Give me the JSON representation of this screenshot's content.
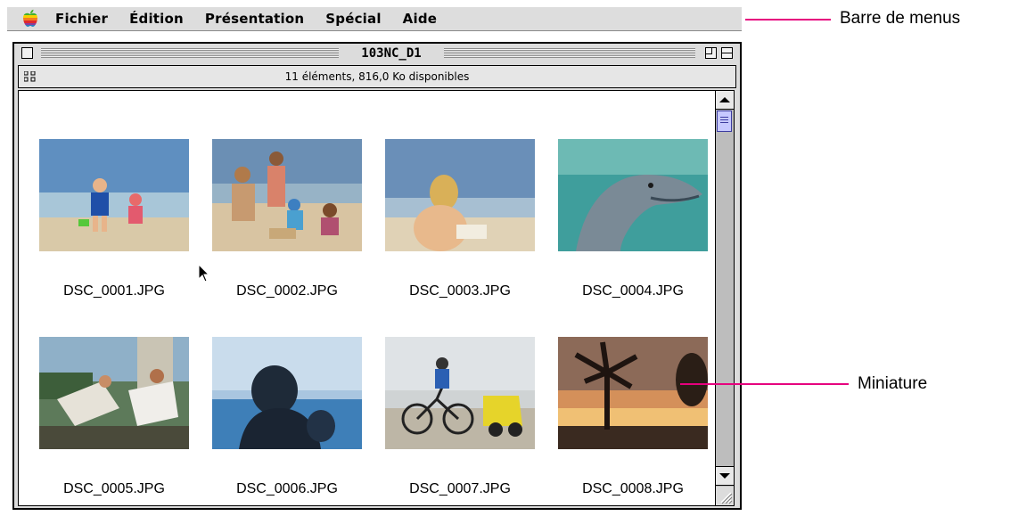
{
  "menubar": {
    "apple_icon": "apple-rainbow-icon",
    "items": [
      "Fichier",
      "Édition",
      "Présentation",
      "Spécial",
      "Aide"
    ]
  },
  "callouts": {
    "menubar_label": "Barre de menus",
    "thumbnail_label": "Miniature",
    "line_color": "#e6007e"
  },
  "window": {
    "title": "103NC_D1",
    "info": "11 éléments, 816,0 Ko disponibles",
    "files": [
      {
        "name": "DSC_0001.JPG",
        "thumbnail": "kids-on-beach-photo"
      },
      {
        "name": "DSC_0002.JPG",
        "thumbnail": "family-sandcastle-photo"
      },
      {
        "name": "DSC_0003.JPG",
        "thumbnail": "girl-reading-on-beach-photo"
      },
      {
        "name": "DSC_0004.JPG",
        "thumbnail": "dolphin-photo"
      },
      {
        "name": "DSC_0005.JPG",
        "thumbnail": "people-in-lounge-chairs-photo"
      },
      {
        "name": "DSC_0006.JPG",
        "thumbnail": "silhouette-by-sea-photo"
      },
      {
        "name": "DSC_0007.JPG",
        "thumbnail": "cyclist-with-trailer-photo"
      },
      {
        "name": "DSC_0008.JPG",
        "thumbnail": "palm-tree-sunset-photo"
      }
    ]
  }
}
